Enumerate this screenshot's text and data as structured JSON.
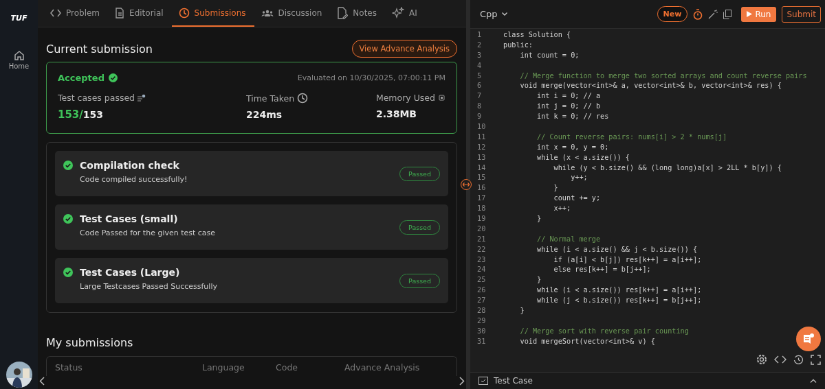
{
  "sidebar": {
    "logo": "TUF",
    "items": [
      {
        "label": "Home",
        "selected": false
      }
    ]
  },
  "tabs": [
    {
      "label": "Problem",
      "selected": false
    },
    {
      "label": "Editorial",
      "selected": false
    },
    {
      "label": "Submissions",
      "selected": true
    },
    {
      "label": "Discussion",
      "selected": false
    },
    {
      "label": "Notes",
      "selected": false
    },
    {
      "label": "AI",
      "selected": false
    }
  ],
  "current_submission": {
    "title": "Current submission",
    "analysis_button": "View Advance Analysis",
    "status": "Accepted",
    "evaluated": "Evaluated on 10/30/2025, 07:00:11 PM",
    "stats": [
      {
        "label": "Test cases passed",
        "passed": "153/",
        "total": "153"
      },
      {
        "label": "Time Taken",
        "value": "224ms"
      },
      {
        "label": "Memory Used",
        "value": "2.38MB"
      }
    ]
  },
  "checks": [
    {
      "title": "Compilation check",
      "detail": "Code compiled successfully!",
      "badge": "Passed",
      "passed": true
    },
    {
      "title": "Test Cases (small)",
      "detail": "Code Passed for the given test case",
      "badge": "Passed",
      "passed": true
    },
    {
      "title": "Test Cases (Large)",
      "detail": "Large Testcases Passed Successfully",
      "badge": "Passed",
      "passed": true
    }
  ],
  "my_submissions": {
    "title": "My submissions",
    "columns": [
      "Status",
      "Language",
      "Code",
      "Advance Analysis"
    ]
  },
  "editor": {
    "language": "Cpp",
    "new_button": "New",
    "run_button": "Run",
    "submit_button": "Submit",
    "lines": [
      {
        "num": "1",
        "text": "class Solution {",
        "kind": "code"
      },
      {
        "num": "2",
        "text": "public:",
        "kind": "code"
      },
      {
        "num": "3",
        "text": "    int count = 0;",
        "kind": "code"
      },
      {
        "num": "4"
      },
      {
        "num": "5",
        "text": "    // Merge function to merge two sorted arrays and count reverse pairs",
        "kind": "comment"
      },
      {
        "num": "6",
        "text": "    void merge(vector<int>& a, vector<int>& b, vector<int>& res) {",
        "kind": "code"
      },
      {
        "num": "7",
        "text": "        int i = 0; // a",
        "kind": "code"
      },
      {
        "num": "8",
        "text": "        int j = 0; // b",
        "kind": "code"
      },
      {
        "num": "9",
        "text": "        int k = 0; // res",
        "kind": "code"
      },
      {
        "num": "10"
      },
      {
        "num": "11",
        "text": "        // Count reverse pairs: nums[i] > 2 * nums[j]",
        "kind": "comment"
      },
      {
        "num": "12",
        "text": "        int x = 0, y = 0;",
        "kind": "code"
      },
      {
        "num": "13",
        "text": "        while (x < a.size()) {",
        "kind": "code"
      },
      {
        "num": "14",
        "text": "            while (y < b.size() && (long long)a[x] > 2LL * b[y]) {",
        "kind": "code"
      },
      {
        "num": "15",
        "text": "                y++;",
        "kind": "code"
      },
      {
        "num": "16",
        "text": "            }",
        "kind": "code"
      },
      {
        "num": "17",
        "text": "            count += y;",
        "kind": "code"
      },
      {
        "num": "18",
        "text": "            x++;",
        "kind": "code"
      },
      {
        "num": "19",
        "text": "        }",
        "kind": "code"
      },
      {
        "num": "20"
      },
      {
        "num": "21",
        "text": "        // Normal merge",
        "kind": "comment"
      },
      {
        "num": "22",
        "text": "        while (i < a.size() && j < b.size()) {",
        "kind": "code"
      },
      {
        "num": "23",
        "text": "            if (a[i] < b[j]) res[k++] = a[i++];",
        "kind": "code"
      },
      {
        "num": "24",
        "text": "            else res[k++] = b[j++];",
        "kind": "code"
      },
      {
        "num": "25",
        "text": "        }",
        "kind": "code"
      },
      {
        "num": "26",
        "text": "        while (i < a.size()) res[k++] = a[i++];",
        "kind": "code"
      },
      {
        "num": "27",
        "text": "        while (j < b.size()) res[k++] = b[j++];",
        "kind": "code"
      },
      {
        "num": "28",
        "text": "    }",
        "kind": "code"
      },
      {
        "num": "29"
      },
      {
        "num": "30",
        "text": "    // Merge sort with reverse pair counting",
        "kind": "comment"
      },
      {
        "num": "31",
        "text": "    void mergeSort(vector<int>& v) {",
        "kind": "code"
      }
    ],
    "test_case_label": "Test Case"
  }
}
